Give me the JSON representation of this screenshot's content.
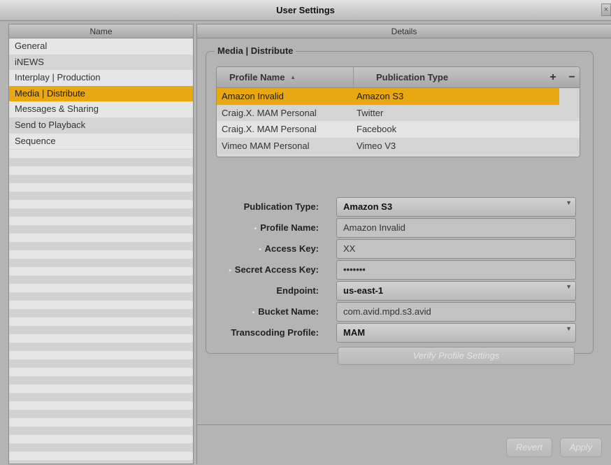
{
  "window": {
    "title": "User Settings",
    "close_glyph": "×"
  },
  "left_panel": {
    "header": "Name",
    "items": [
      {
        "label": "General"
      },
      {
        "label": "iNEWS"
      },
      {
        "label": "Interplay | Production"
      },
      {
        "label": "Media | Distribute",
        "selected": true
      },
      {
        "label": "Messages & Sharing"
      },
      {
        "label": "Send to Playback"
      },
      {
        "label": "Sequence"
      }
    ]
  },
  "right_panel": {
    "header": "Details",
    "group_title": "Media | Distribute",
    "table": {
      "columns": [
        "Profile Name",
        "Publication Type"
      ],
      "sort_indicator": "▲",
      "add_label": "+",
      "remove_label": "−",
      "rows": [
        {
          "name": "Amazon Invalid",
          "type": "Amazon S3",
          "selected": true
        },
        {
          "name": "Craig.X. MAM Personal",
          "type": "Twitter"
        },
        {
          "name": "Craig.X. MAM Personal",
          "type": "Facebook"
        },
        {
          "name": "Vimeo MAM Personal",
          "type": "Vimeo V3"
        }
      ]
    },
    "form": {
      "publication_type": {
        "label": "Publication Type:",
        "value": "Amazon S3"
      },
      "profile_name": {
        "label": "Profile Name:",
        "value": "Amazon Invalid"
      },
      "access_key": {
        "label": "Access Key:",
        "value": "XX"
      },
      "secret_access_key": {
        "label": "Secret Access Key:",
        "value": "•••••••"
      },
      "endpoint": {
        "label": "Endpoint:",
        "value": "us-east-1"
      },
      "bucket_name": {
        "label": "Bucket Name:",
        "value": "com.avid.mpd.s3.avid"
      },
      "transcoding_profile": {
        "label": "Transcoding Profile:",
        "value": "MAM"
      },
      "required_marker": "•",
      "dropdown_arrow": "▼"
    },
    "verify_button": "Verify Profile Settings",
    "footer": {
      "revert": "Revert",
      "apply": "Apply"
    }
  },
  "colors": {
    "selection": "#e8a812",
    "background": "#b4b4b4"
  }
}
